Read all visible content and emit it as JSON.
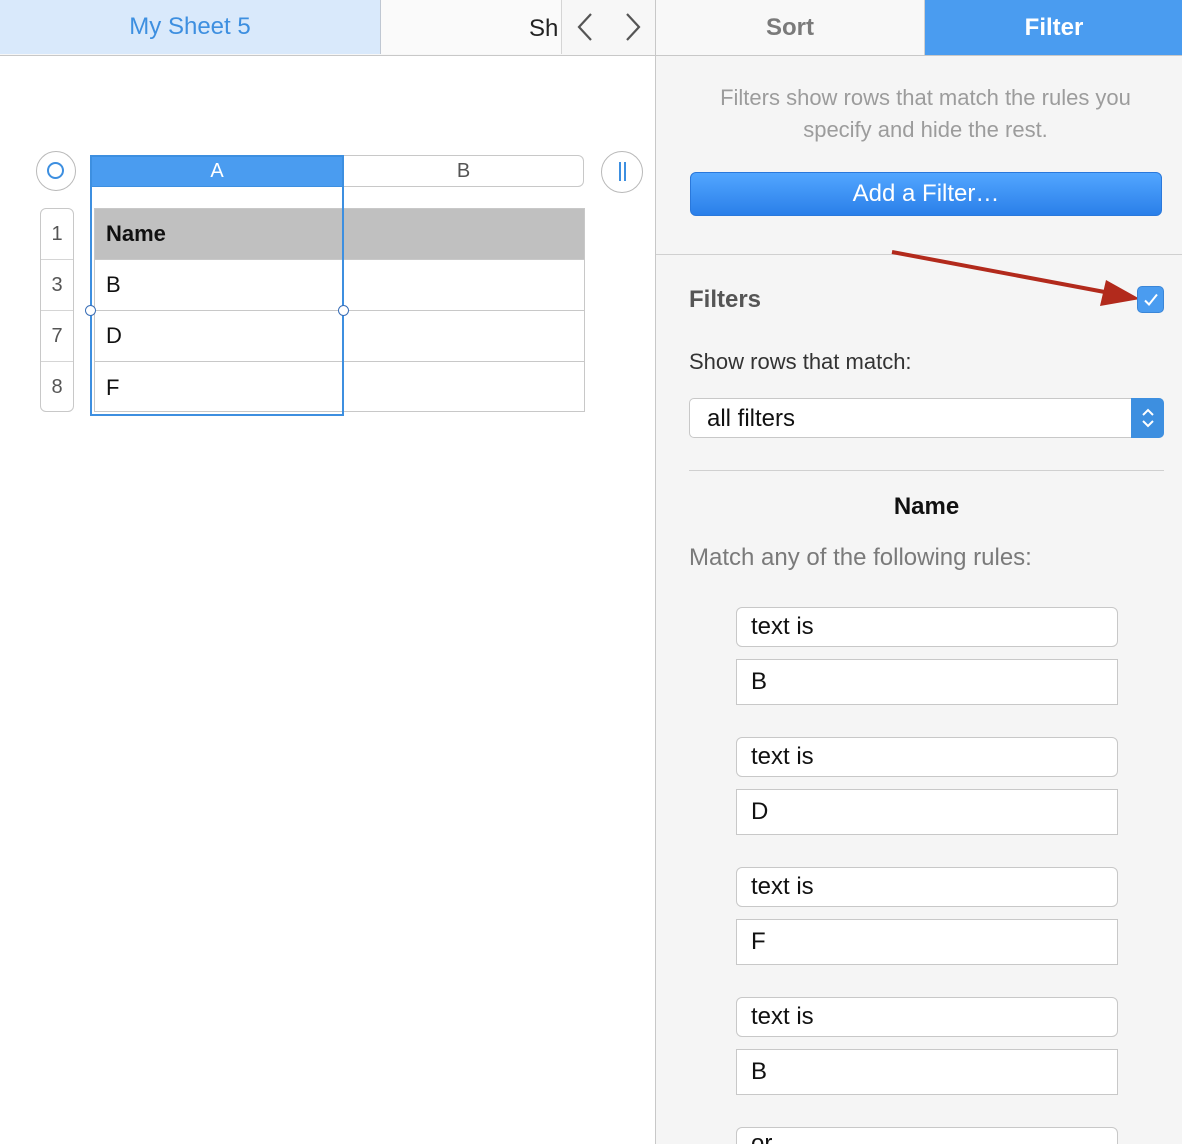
{
  "tabs": {
    "active": "My Sheet 5",
    "other": "Sh"
  },
  "sheet": {
    "columns": [
      "A",
      "B"
    ],
    "rows": [
      {
        "num": "1",
        "a": "Name",
        "b": ""
      },
      {
        "num": "3",
        "a": "B",
        "b": ""
      },
      {
        "num": "7",
        "a": "D",
        "b": ""
      },
      {
        "num": "8",
        "a": "F",
        "b": ""
      }
    ]
  },
  "inspector": {
    "tabs": {
      "sort": "Sort",
      "filter": "Filter"
    },
    "intro": "Filters show rows that match the rules you specify and hide the rest.",
    "add_button": "Add a Filter…",
    "filters_title": "Filters",
    "filters_enabled": true,
    "show_rows_label": "Show rows that match:",
    "match_mode": "all filters",
    "column_name": "Name",
    "match_label": "Match any of the following rules:",
    "rules": [
      {
        "op": "text is",
        "value": "B"
      },
      {
        "op": "text is",
        "value": "D"
      },
      {
        "op": "text is",
        "value": "F"
      },
      {
        "op": "text is",
        "value": "B"
      }
    ],
    "partial_rule": "or"
  },
  "colors": {
    "accent": "#4a9cf0",
    "arrow": "#b22a1c",
    "header_fill": "#c0c0c0"
  }
}
